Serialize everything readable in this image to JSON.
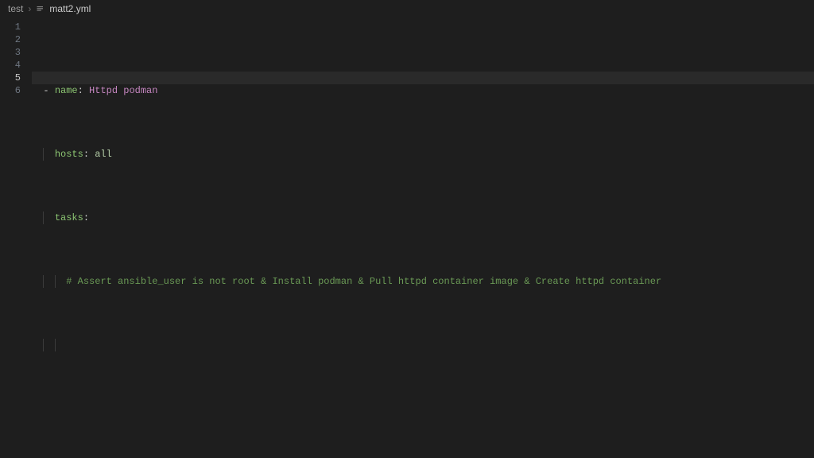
{
  "breadcrumb": {
    "folder": "test",
    "file": "matt2.yml"
  },
  "gutter": {
    "lines": [
      "1",
      "2",
      "3",
      "4",
      "5",
      "6"
    ],
    "current": 5
  },
  "code": {
    "line1": {
      "dash": "-",
      "key": "name",
      "colon": ":",
      "value": "Httpd podman"
    },
    "line2": {
      "key": "hosts",
      "colon": ":",
      "value": "all"
    },
    "line3": {
      "key": "tasks",
      "colon": ":"
    },
    "line4": {
      "comment": "# Assert ansible_user is not root & Install podman & Pull httpd container image & Create httpd container"
    }
  }
}
